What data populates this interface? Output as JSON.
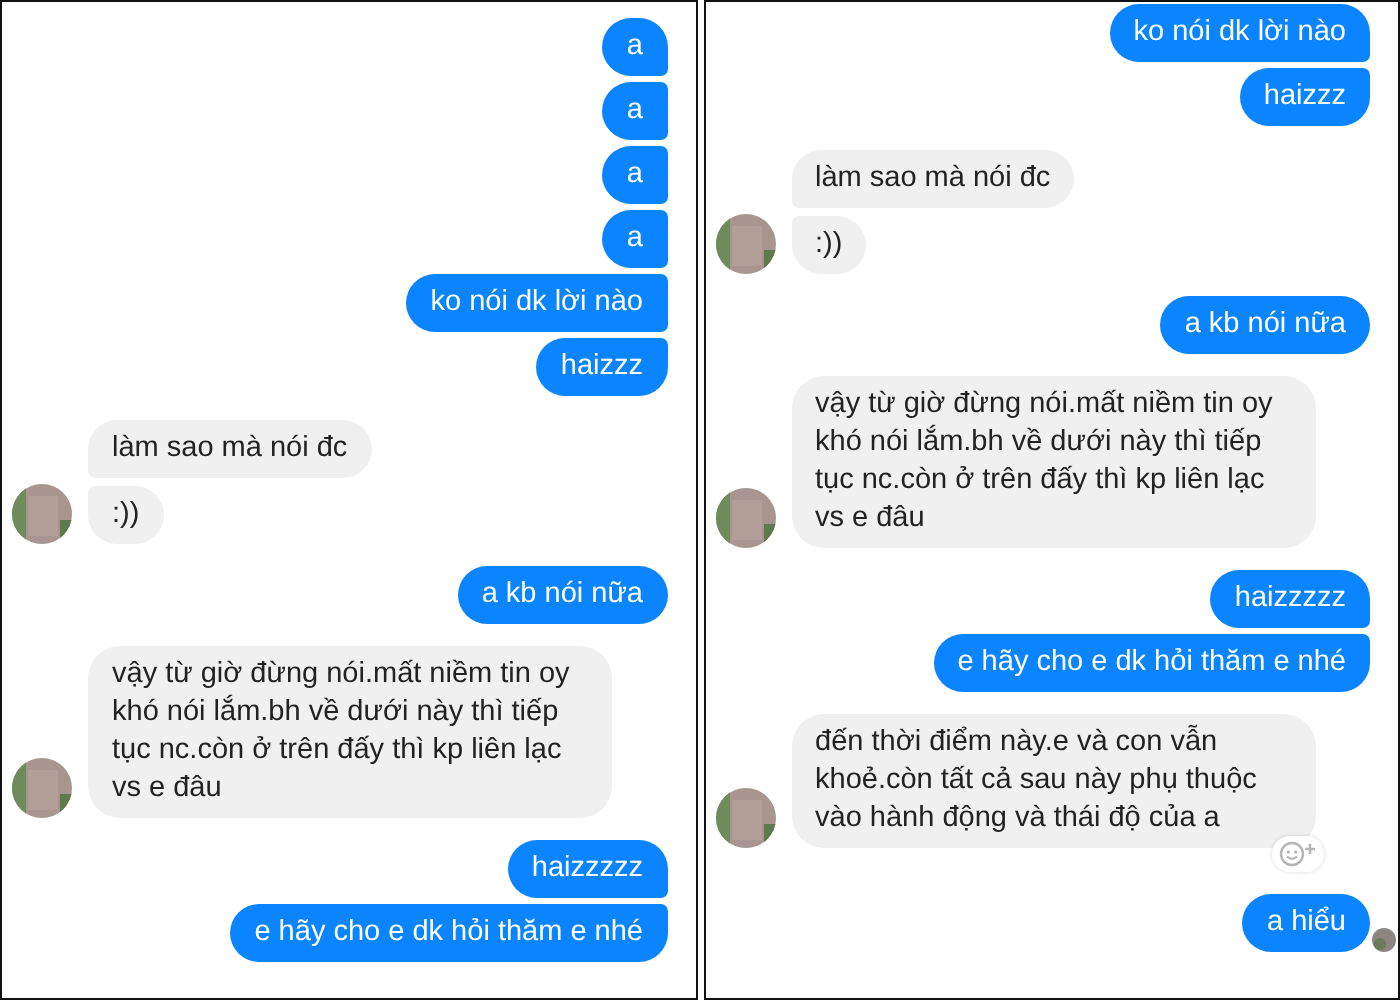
{
  "panels": [
    {
      "messages": [
        {
          "kind": "sent",
          "text": "a"
        },
        {
          "kind": "sent",
          "text": "a"
        },
        {
          "kind": "sent",
          "text": "a"
        },
        {
          "kind": "sent",
          "text": "a"
        },
        {
          "kind": "sent",
          "text": "ko nói dk lời nào"
        },
        {
          "kind": "sent",
          "text": "haizzz"
        },
        {
          "kind": "received",
          "text": "làm sao mà nói đc",
          "avatar": false
        },
        {
          "kind": "received",
          "text": ":))",
          "avatar": true
        },
        {
          "kind": "sent",
          "text": "a kb nói nữa"
        },
        {
          "kind": "received",
          "text": "vậy từ giờ đừng nói.mất niềm tin oy khó nói lắm.bh về dưới này thì tiếp tục nc.còn ở trên đấy thì kp liên lạc vs e đâu",
          "avatar": true
        },
        {
          "kind": "sent",
          "text": "haizzzzz"
        },
        {
          "kind": "sent",
          "text": "e hãy cho e dk hỏi thăm e nhé"
        }
      ]
    },
    {
      "messages": [
        {
          "kind": "sent",
          "text": "ko nói dk lời nào"
        },
        {
          "kind": "sent",
          "text": "haizzz"
        },
        {
          "kind": "received",
          "text": "làm sao mà nói đc",
          "avatar": false
        },
        {
          "kind": "received",
          "text": ":))",
          "avatar": true
        },
        {
          "kind": "sent",
          "text": "a kb nói nữa"
        },
        {
          "kind": "received",
          "text": "vậy từ giờ đừng nói.mất niềm tin oy khó nói lắm.bh về dưới này thì tiếp tục nc.còn ở trên đấy thì kp liên lạc vs e đâu",
          "avatar": true
        },
        {
          "kind": "sent",
          "text": "haizzzzz"
        },
        {
          "kind": "sent",
          "text": "e hãy cho e dk hỏi thăm e nhé"
        },
        {
          "kind": "received",
          "text": "đến thời điểm này.e và con vẫn khoẻ.còn tất cả sau này phụ thuộc vào hành động và thái độ của a",
          "avatar": true,
          "reaction_button": true
        },
        {
          "kind": "sent",
          "text": "a hiểu",
          "seen": true
        }
      ]
    }
  ]
}
